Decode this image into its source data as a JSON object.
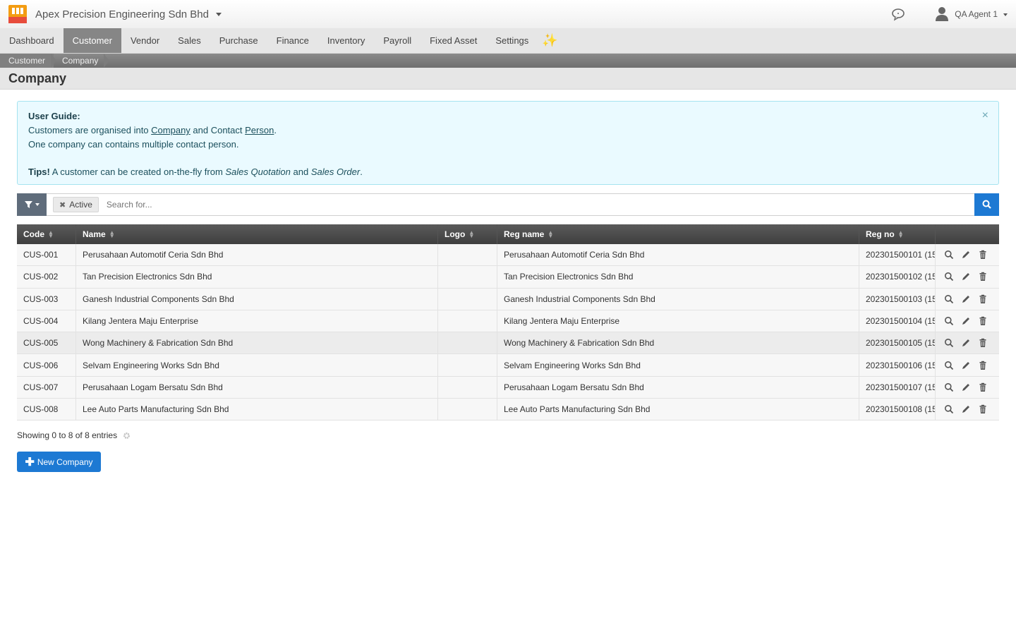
{
  "header": {
    "company_name": "Apex Precision Engineering Sdn Bhd",
    "user_name": "QA Agent 1"
  },
  "nav": {
    "items": [
      "Dashboard",
      "Customer",
      "Vendor",
      "Sales",
      "Purchase",
      "Finance",
      "Inventory",
      "Payroll",
      "Fixed Asset",
      "Settings"
    ],
    "active": "Customer",
    "extra_icon": "sparkles-icon"
  },
  "breadcrumb": [
    "Customer",
    "Company"
  ],
  "page_title": "Company",
  "guide": {
    "title": "User Guide:",
    "line1_pre": "Customers are organised into ",
    "line1_link1": "Company",
    "line1_mid": " and Contact ",
    "line1_link2": "Person",
    "line1_post": ".",
    "line2": "One company can contains multiple contact person.",
    "tips_label": "Tips!",
    "tips_pre": " A customer can be created on-the-fly from ",
    "tips_em1": "Sales Quotation",
    "tips_mid": " and ",
    "tips_em2": "Sales Order",
    "tips_post": "."
  },
  "search": {
    "chip_label": "Active",
    "placeholder": "Search for..."
  },
  "table": {
    "columns": [
      "Code",
      "Name",
      "Logo",
      "Reg name",
      "Reg no"
    ],
    "rows": [
      {
        "code": "CUS-001",
        "name": "Perusahaan Automotif Ceria Sdn Bhd",
        "logo": "",
        "reg_name": "Perusahaan Automotif Ceria Sdn Bhd",
        "reg_no": "202301500101 (15"
      },
      {
        "code": "CUS-002",
        "name": "Tan Precision Electronics Sdn Bhd",
        "logo": "",
        "reg_name": "Tan Precision Electronics Sdn Bhd",
        "reg_no": "202301500102 (15"
      },
      {
        "code": "CUS-003",
        "name": "Ganesh Industrial Components Sdn Bhd",
        "logo": "",
        "reg_name": "Ganesh Industrial Components Sdn Bhd",
        "reg_no": "202301500103 (15"
      },
      {
        "code": "CUS-004",
        "name": "Kilang Jentera Maju Enterprise",
        "logo": "",
        "reg_name": "Kilang Jentera Maju Enterprise",
        "reg_no": "202301500104 (15"
      },
      {
        "code": "CUS-005",
        "name": "Wong Machinery & Fabrication Sdn Bhd",
        "logo": "",
        "reg_name": "Wong Machinery & Fabrication Sdn Bhd",
        "reg_no": "202301500105 (15"
      },
      {
        "code": "CUS-006",
        "name": "Selvam Engineering Works Sdn Bhd",
        "logo": "",
        "reg_name": "Selvam Engineering Works Sdn Bhd",
        "reg_no": "202301500106 (15"
      },
      {
        "code": "CUS-007",
        "name": "Perusahaan Logam Bersatu Sdn Bhd",
        "logo": "",
        "reg_name": "Perusahaan Logam Bersatu Sdn Bhd",
        "reg_no": "202301500107 (15"
      },
      {
        "code": "CUS-008",
        "name": "Lee Auto Parts Manufacturing Sdn Bhd",
        "logo": "",
        "reg_name": "Lee Auto Parts Manufacturing Sdn Bhd",
        "reg_no": "202301500108 (15"
      }
    ],
    "hover_row": 4
  },
  "footer": {
    "entries": "Showing 0 to 8 of 8 entries",
    "new_button": "New Company"
  },
  "colors": {
    "accent": "#1d79d3",
    "nav_active": "#868686",
    "guide_bg": "#eafaff"
  }
}
